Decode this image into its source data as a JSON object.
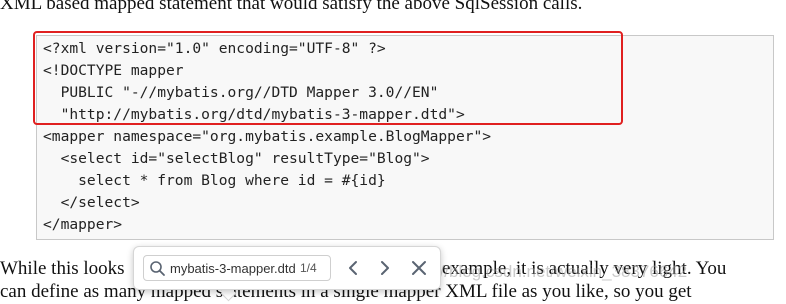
{
  "document": {
    "intro_line": "XML based mapped statement that would satisfy the above SqlSession calls.",
    "code_lines": [
      "<?xml version=\"1.0\" encoding=\"UTF-8\" ?>",
      "<!DOCTYPE mapper",
      "  PUBLIC \"-//mybatis.org//DTD Mapper 3.0//EN\"",
      "  \"http://mybatis.org/dtd/mybatis-3-mapper.dtd\">",
      "<mapper namespace=\"org.mybatis.example.BlogMapper\">",
      "  <select id=\"selectBlog\" resultType=\"Blog\">",
      "    select * from Blog where id = #{id}",
      "  </select>",
      "</mapper>"
    ],
    "para_line_1_start": "While this looks",
    "para_line_1_end": "example, it is actually very light. You",
    "para_line_2": "can define as many mapped statements in a single mapper XML file as you like, so you get"
  },
  "watermark": "https://blog.csdn.net/weixin_38376642",
  "find_bar": {
    "query": "mybatis-3-mapper.dtd",
    "match_count": "1/4",
    "icons": [
      "search-icon",
      "chevron-left-icon",
      "chevron-right-icon",
      "close-icon"
    ]
  },
  "colors": {
    "highlight": "#e02020",
    "code_bg": "#f8f8f8",
    "icon": "#5a6472"
  }
}
